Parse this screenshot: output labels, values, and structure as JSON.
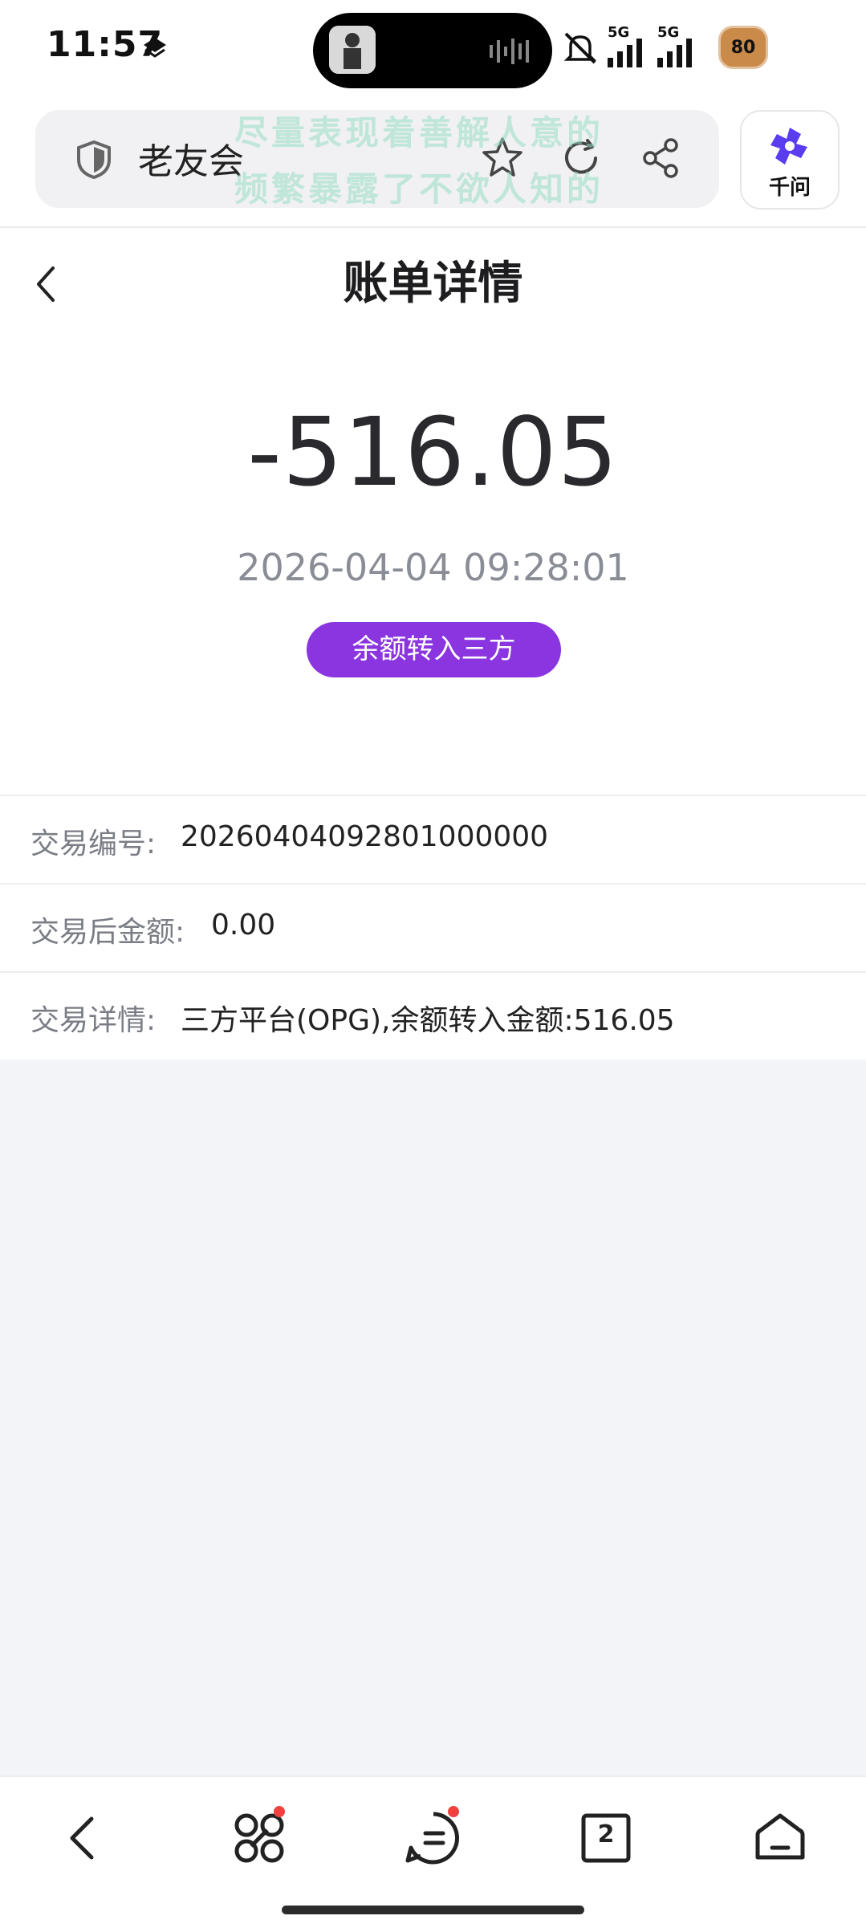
{
  "status_bar": {
    "time": "11:57",
    "network_1": "5G",
    "network_2": "5G",
    "battery_level": "80"
  },
  "browser": {
    "site_name": "老友会",
    "overlay_line_1": "尽量表现着善解人意的",
    "overlay_line_2": "频繁暴露了不欲人知的",
    "assistant_label": "千问"
  },
  "page": {
    "title": "账单详情",
    "amount": "-516.05",
    "datetime": "2026-04-04 09:28:01",
    "type_badge": "余额转入三方",
    "rows": [
      {
        "label": "交易编号:",
        "value": "20260404092801000000"
      },
      {
        "label": "交易后金额:",
        "value": "0.00"
      },
      {
        "label": "交易详情:",
        "value": "三方平台(OPG),余额转入金额:516.05"
      }
    ]
  },
  "bottom_nav": {
    "tab_count": "2"
  },
  "colors": {
    "accent": "#8a35e0",
    "badge_dot": "#f0413f",
    "assistant_brand": "#5b3df0"
  }
}
